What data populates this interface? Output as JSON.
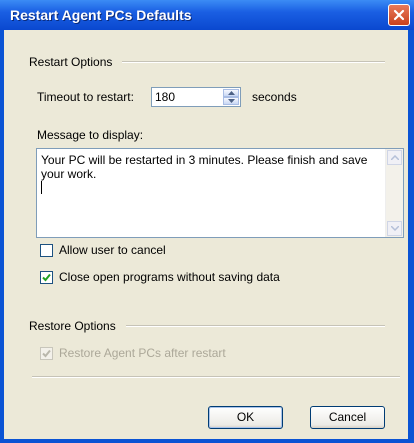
{
  "window": {
    "title": "Restart Agent PCs Defaults"
  },
  "restart_options": {
    "group_label": "Restart Options",
    "timeout_label": "Timeout to restart:",
    "timeout_value": "180",
    "timeout_unit": "seconds",
    "message_label": "Message to display:",
    "message_value": "Your PC will be restarted in 3 minutes. Please finish and save your work.",
    "allow_cancel_label": "Allow user to cancel",
    "allow_cancel_checked": false,
    "close_programs_label": "Close open programs without saving data",
    "close_programs_checked": true
  },
  "restore_options": {
    "group_label": "Restore Options",
    "restore_after_label": "Restore Agent PCs after restart",
    "restore_after_checked": true,
    "restore_after_enabled": false
  },
  "buttons": {
    "ok_label": "OK",
    "cancel_label": "Cancel"
  },
  "colors": {
    "title_bar": "#0a53d4",
    "close_button": "#c9411c",
    "dialog_face": "#ece9d8"
  }
}
